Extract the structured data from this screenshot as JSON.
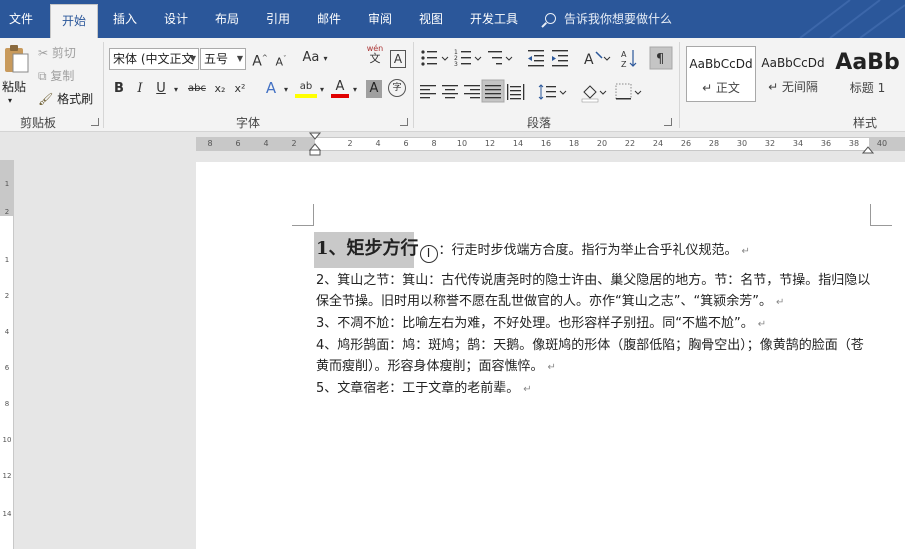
{
  "tabs": [
    "文件",
    "开始",
    "插入",
    "设计",
    "布局",
    "引用",
    "邮件",
    "审阅",
    "视图",
    "开发工具"
  ],
  "active_tab": "开始",
  "tellme": "告诉我你想要做什么",
  "clipboard": {
    "paste": "粘贴",
    "cut": "剪切",
    "copy": "复制",
    "format_painter": "格式刷",
    "group": "剪贴板"
  },
  "font": {
    "name": "宋体 (中文正文",
    "size": "五号",
    "group": "字体",
    "aa_label": "Aa",
    "wen": "wén",
    "boxed_a": "A",
    "bold": "B",
    "italic": "I",
    "underline": "U",
    "strike": "abc",
    "sub": "x₂",
    "sup": "x²",
    "grow": "A",
    "shrink": "A",
    "effect": "A",
    "highlight": "ab",
    "color": "A",
    "shade": "A",
    "circle": "字"
  },
  "paragraph": {
    "group": "段落"
  },
  "styles": {
    "group": "样式",
    "items": [
      {
        "preview": "AaBbCcDd",
        "name": "↵ 正文"
      },
      {
        "preview": "AaBbCcDd",
        "name": "↵ 无间隔"
      },
      {
        "preview": "AaBb",
        "name": "标题 1"
      }
    ]
  },
  "ruler": {
    "numbers": [
      "8",
      "6",
      "4",
      "2",
      "2",
      "4",
      "6",
      "8",
      "10",
      "12",
      "14",
      "16",
      "18",
      "20",
      "22",
      "24",
      "26",
      "28",
      "30",
      "32",
      "34",
      "36",
      "38",
      "40"
    ]
  },
  "vruler": {
    "numbers": [
      "1",
      "2",
      "1",
      "2",
      "4",
      "6",
      "8",
      "10",
      "12",
      "14"
    ]
  },
  "document": {
    "heading": "1、矩步方行",
    "heading_rest": "：行走时步伐端方合度。指行为举止合乎礼仪规范。",
    "pmark": "↵",
    "paragraphs": [
      "2、箕山之节：箕山：古代传说唐尧时的隐士许由、巢父隐居的地方。节：名节，节操。指归隐以保全节操。旧时用以称誉不愿在乱世做官的人。亦作“箕山之志”、“箕颍余芳”。",
      "3、不凋不尬：比喻左右为难，不好处理。也形容样子别扭。同“不尴不尬”。",
      "4、鸠形鹄面：鸠：斑鸠；鹄：天鹅。像斑鸠的形体（腹部低陷；胸骨空出）；像黄鹄的脸面（苍黄而瘦削）。形容身体瘦削；面容憔悴。",
      "5、文章宿老：工于文章的老前辈。"
    ]
  }
}
